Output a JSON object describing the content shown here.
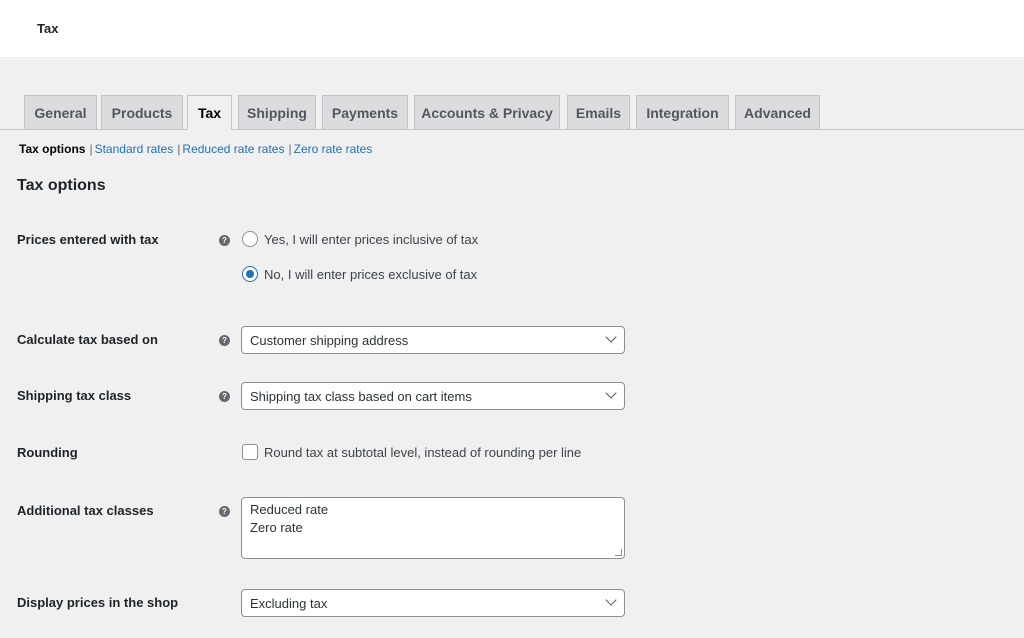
{
  "header": {
    "title": "Tax"
  },
  "tabs": [
    {
      "label": "General"
    },
    {
      "label": "Products"
    },
    {
      "label": "Tax",
      "active": true
    },
    {
      "label": "Shipping"
    },
    {
      "label": "Payments"
    },
    {
      "label": "Accounts & Privacy"
    },
    {
      "label": "Emails"
    },
    {
      "label": "Integration"
    },
    {
      "label": "Advanced"
    }
  ],
  "subnav": {
    "current": "Tax options",
    "links": [
      "Standard rates",
      "Reduced rate rates",
      "Zero rate rates"
    ]
  },
  "section": {
    "title": "Tax options"
  },
  "fields": {
    "prices_entered": {
      "label": "Prices entered with tax",
      "options": [
        "Yes, I will enter prices inclusive of tax",
        "No, I will enter prices exclusive of tax"
      ],
      "selected_index": 1
    },
    "calculate_based_on": {
      "label": "Calculate tax based on",
      "value": "Customer shipping address"
    },
    "shipping_tax_class": {
      "label": "Shipping tax class",
      "value": "Shipping tax class based on cart items"
    },
    "rounding": {
      "label": "Rounding",
      "checkbox_label": "Round tax at subtotal level, instead of rounding per line",
      "checked": false
    },
    "additional_classes": {
      "label": "Additional tax classes",
      "lines": [
        "Reduced rate",
        "Zero rate"
      ]
    },
    "display_prices_shop": {
      "label": "Display prices in the shop",
      "value": "Excluding tax"
    }
  },
  "icons": {
    "help": "help-icon",
    "dropdown": "chevron-down-icon"
  },
  "colors": {
    "link": "#2271b1",
    "background": "#f0f0f1",
    "tab_inactive": "#dcdcde"
  }
}
